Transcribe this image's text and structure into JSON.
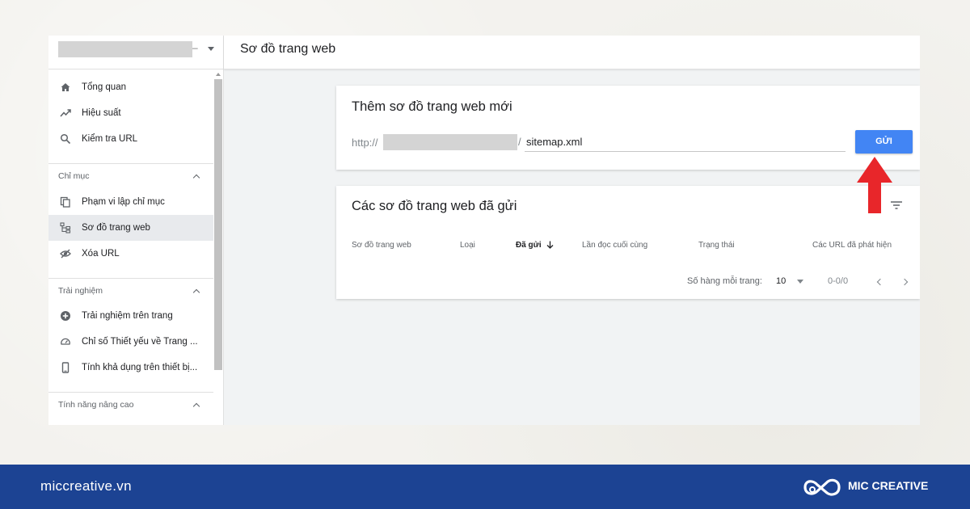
{
  "header": {
    "title": "Sơ đồ trang web"
  },
  "property": {
    "dash": "–"
  },
  "sidebar": {
    "top_items": [
      {
        "label": "Tổng quan",
        "icon": "home-icon"
      },
      {
        "label": "Hiệu suất",
        "icon": "trending-icon"
      },
      {
        "label": "Kiểm tra URL",
        "icon": "search-icon"
      }
    ],
    "sections": [
      {
        "title": "Chỉ mục",
        "items": [
          {
            "label": "Phạm vi lập chỉ mục",
            "icon": "copy-icon"
          },
          {
            "label": "Sơ đồ trang web",
            "icon": "sitemap-icon",
            "active": true
          },
          {
            "label": "Xóa URL",
            "icon": "eye-off-icon"
          }
        ]
      },
      {
        "title": "Trải nghiệm",
        "items": [
          {
            "label": "Trải nghiệm trên trang",
            "icon": "plus-circle-icon"
          },
          {
            "label": "Chỉ số Thiết yếu về Trang ...",
            "icon": "speedometer-icon"
          },
          {
            "label": "Tính khả dụng trên thiết bị...",
            "icon": "phone-icon"
          }
        ]
      },
      {
        "title": "Tính năng nâng cao",
        "items": []
      }
    ]
  },
  "add_card": {
    "title": "Thêm sơ đồ trang web mới",
    "prefix": "http://",
    "slash": "/",
    "input_value": "sitemap.xml",
    "submit_label": "GỬI"
  },
  "submitted_card": {
    "title": "Các sơ đồ trang web đã gửi",
    "columns": [
      "Sơ đồ trang web",
      "Loại",
      "Đã gửi",
      "Lần đọc cuối cùng",
      "Trạng thái",
      "Các URL đã phát hiện"
    ],
    "pager": {
      "rows_label": "Số hàng mỗi trang:",
      "rows_value": "10",
      "range": "0-0/0"
    }
  },
  "footer": {
    "site": "miccreative.vn",
    "brand": "MIC CREATIVE"
  },
  "colors": {
    "accent": "#4285f4",
    "arrow": "#e8262a",
    "footer": "#1c4393"
  }
}
